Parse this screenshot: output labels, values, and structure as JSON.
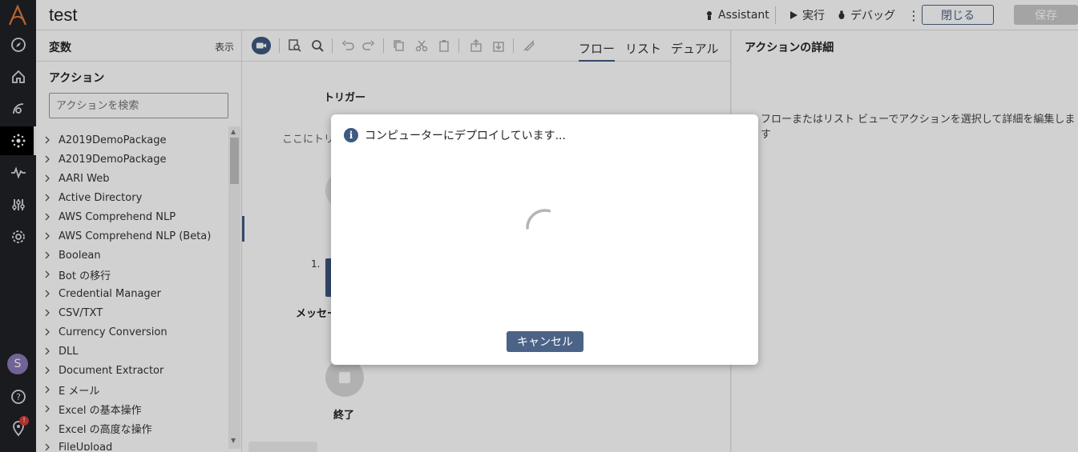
{
  "header": {
    "bot_title": "test",
    "assistant_label": "Assistant",
    "run_label": "実行",
    "debug_label": "デバッグ",
    "close_label": "閉じる",
    "save_label": "保存"
  },
  "rail": {
    "avatar_initial": "S",
    "notification_badge": "!"
  },
  "left_panel": {
    "variables_title": "変数",
    "variables_show": "表示",
    "actions_title": "アクション",
    "search_placeholder": "アクションを検索",
    "actions": [
      "A2019DemoPackage",
      "A2019DemoPackage",
      "AARI Web",
      "Active Directory",
      "AWS Comprehend NLP",
      "AWS Comprehend NLP (Beta)",
      "Boolean",
      "Bot の移行",
      "Credential Manager",
      "CSV/TXT",
      "Currency Conversion",
      "DLL",
      "Document Extractor",
      "E メール",
      "Excel の基本操作",
      "Excel の高度な操作",
      "FileUpload"
    ]
  },
  "canvas": {
    "tabs": [
      "フロー",
      "リスト",
      "デュアル"
    ],
    "active_tab": "フロー",
    "trigger_label": "トリガー",
    "trigger_hint": "ここにトリ",
    "step_number": "1.",
    "step_label": "メッセー",
    "end_label": "終了"
  },
  "details": {
    "title": "アクションの詳細",
    "hint": "フローまたはリスト ビューでアクションを選択して詳細を編集します"
  },
  "modal": {
    "title": "コンピューターにデプロイしています...",
    "cancel_label": "キャンセル"
  },
  "colors": {
    "accent": "#3d5a80",
    "rail_bg": "#1f2226",
    "button_primary": "#4a6386",
    "logo": "#e07b39"
  }
}
